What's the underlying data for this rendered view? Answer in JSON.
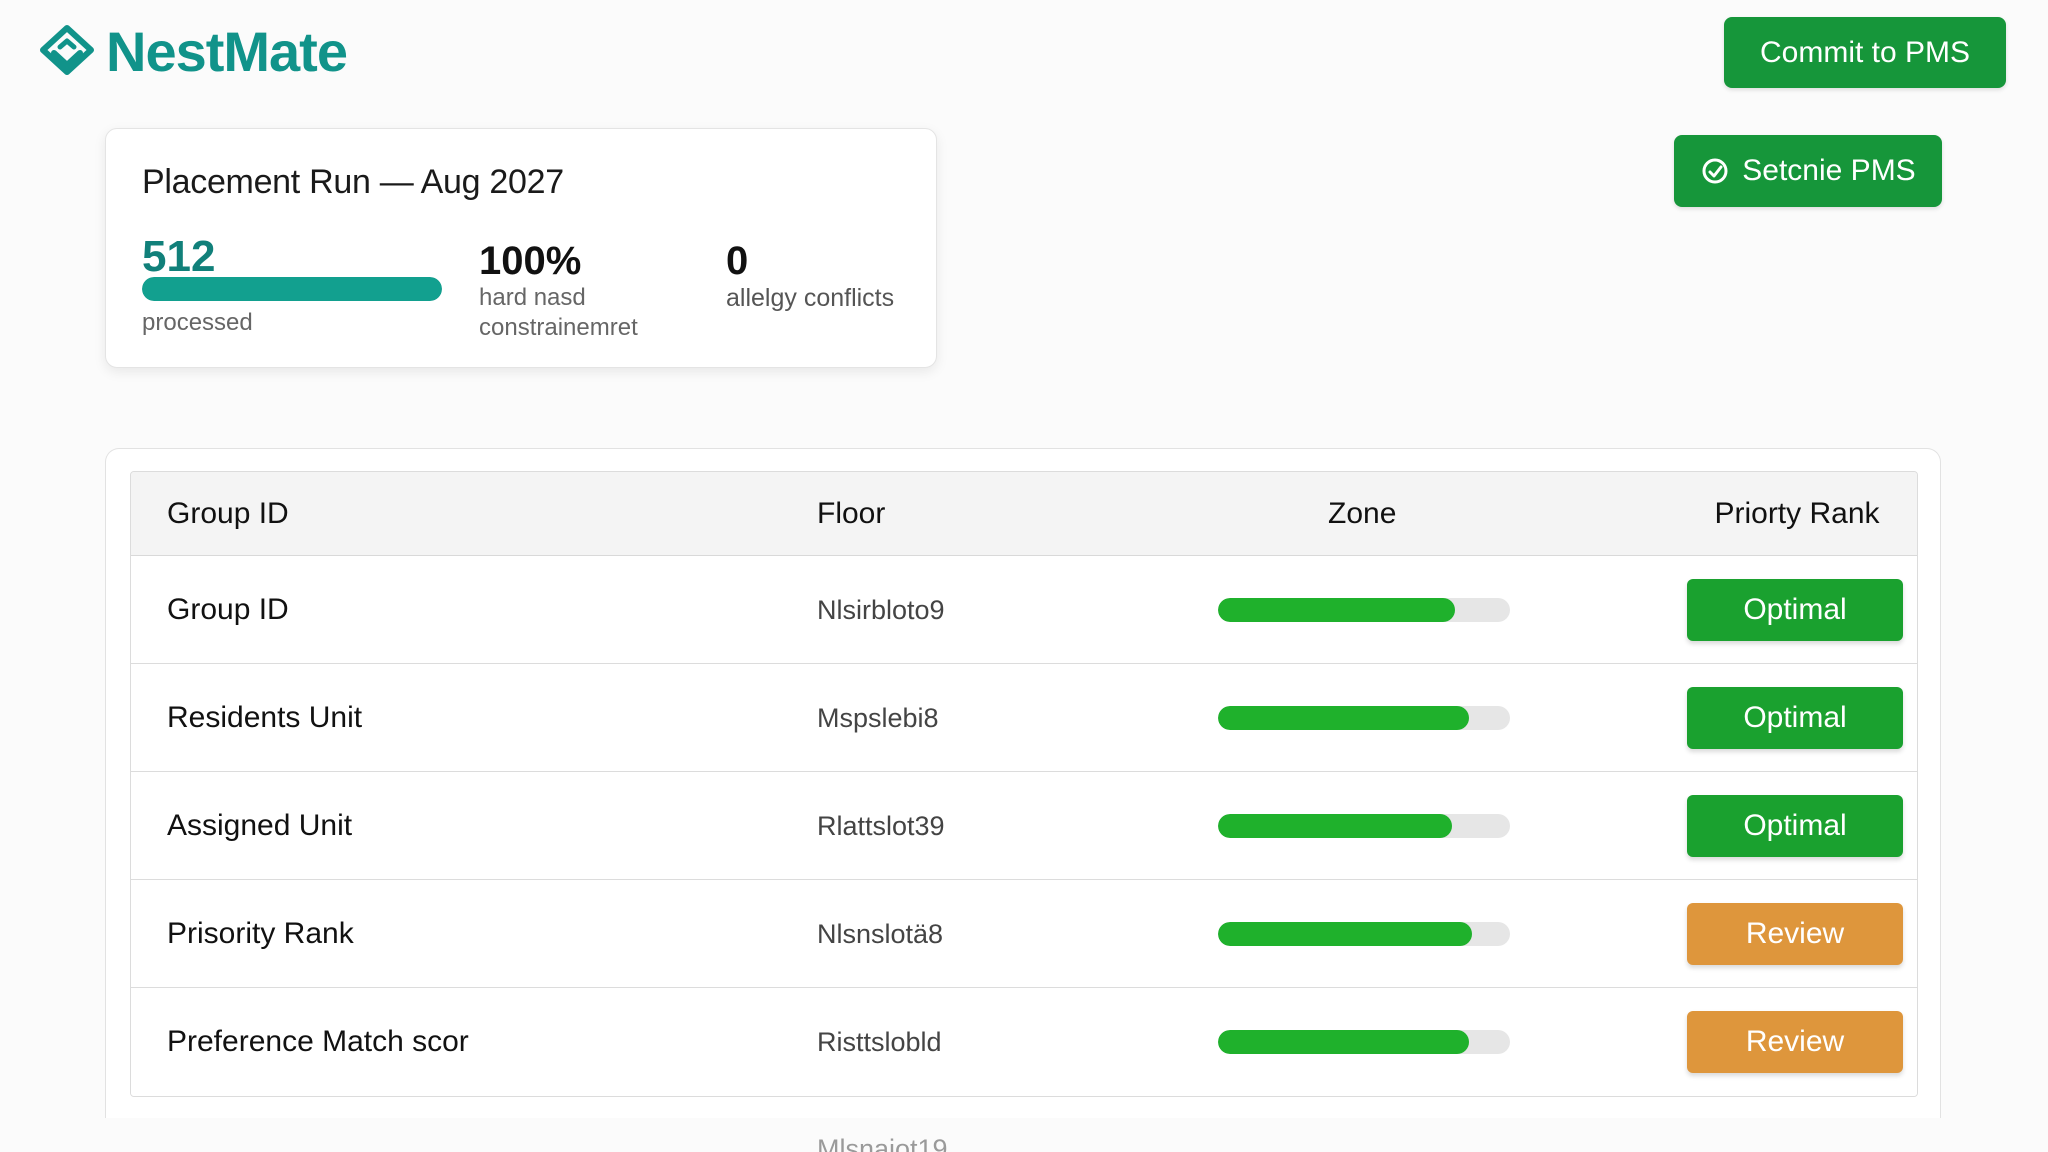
{
  "app": {
    "name": "NestMate",
    "brand_color": "#11938a"
  },
  "header": {
    "commit_button": "Commit to PMS",
    "secondary_button": "Setcnie PMS",
    "secondary_icon": "link-icon"
  },
  "summary": {
    "title": "Placement Run — Aug 2027",
    "processed": {
      "value": "512",
      "label": "processed",
      "progress": 1.0
    },
    "hard_constraints": {
      "value": "100%",
      "label": "hard nasd constrainemret"
    },
    "allergy": {
      "value": "0",
      "label": "allelgy conflicts"
    }
  },
  "table": {
    "headers": {
      "group": "Group ID",
      "floor": "Floor",
      "zone": "Zone",
      "rank": "Priorty Rank"
    },
    "rows": [
      {
        "group": "Group ID",
        "floor": "Nlsirbloto9",
        "zone_fill": 0.81,
        "rank": "Optimal",
        "status": "optimal"
      },
      {
        "group": "Residents Unit",
        "floor": "Mspslebi8",
        "zone_fill": 0.86,
        "rank": "Optimal",
        "status": "optimal"
      },
      {
        "group": "Assigned Unit",
        "floor": "Rlattslot39",
        "zone_fill": 0.8,
        "rank": "Optimal",
        "status": "optimal"
      },
      {
        "group": "Prisority Rank",
        "floor": "Nlsnslotä8",
        "zone_fill": 0.87,
        "rank": "Review",
        "status": "review"
      },
      {
        "group": "Preference Match scor",
        "floor": "Risttslobld",
        "zone_fill": 0.86,
        "rank": "Review",
        "status": "review"
      }
    ],
    "overflow_row_floor": "Mlsnaiot19"
  },
  "colors": {
    "optimal": "#1aa12f",
    "review": "#de963c",
    "zone_bar": "#1fb12c",
    "primary_button": "#16963a"
  }
}
